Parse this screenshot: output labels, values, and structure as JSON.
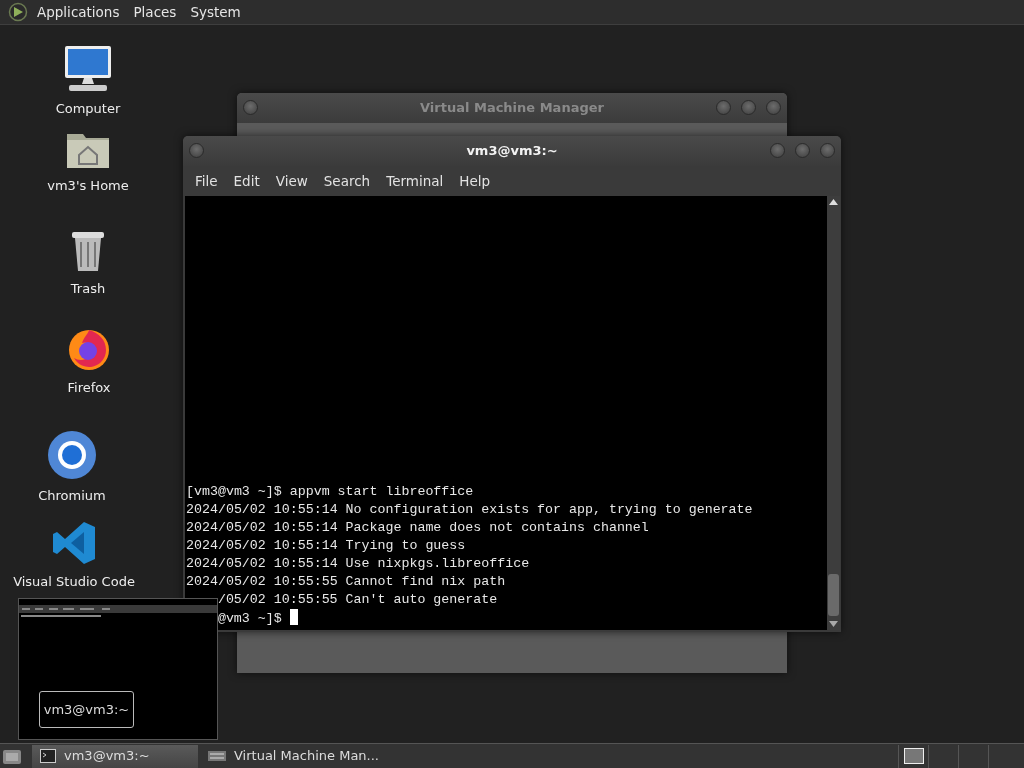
{
  "top_panel": {
    "menus": [
      "Applications",
      "Places",
      "System"
    ]
  },
  "desktop_icons": [
    {
      "label": "Computer",
      "kind": "computer"
    },
    {
      "label": "vm3's Home",
      "kind": "home"
    },
    {
      "label": "Trash",
      "kind": "trash"
    },
    {
      "label": "Firefox",
      "kind": "firefox"
    },
    {
      "label": "Chromium",
      "kind": "chromium"
    },
    {
      "label": "Visual Studio Code",
      "kind": "vscode"
    }
  ],
  "background_window": {
    "title": "Virtual Machine Manager",
    "active": false
  },
  "terminal_window": {
    "title": "vm3@vm3:~",
    "active": true,
    "menus": [
      "File",
      "Edit",
      "View",
      "Search",
      "Terminal",
      "Help"
    ],
    "lines": [
      {
        "text": "[vm3@vm3 ~]$ appvm start libreoffice",
        "kind": "full"
      },
      {
        "text": "2024/05/02 10:55:14 No configuration exists for app, trying to generate",
        "kind": "full"
      },
      {
        "text": "2024/05/02 10:55:14 Package name does not contains channel",
        "kind": "full"
      },
      {
        "text": "2024/05/02 10:55:14 Trying to guess",
        "kind": "full"
      },
      {
        "text": "2024/05/02 10:55:14 Use nixpkgs.libreoffice",
        "kind": "full"
      },
      {
        "text": "2024/05/02 10:55:55 Cannot find nix path",
        "kind": "full"
      },
      {
        "text": "/05/02 10:55:55 Can't auto generate",
        "kind": "cut"
      },
      {
        "text": "@vm3 ~]$",
        "kind": "cut",
        "cursor": true
      }
    ]
  },
  "window_preview": {
    "label": "vm3@vm3:~"
  },
  "taskbar": {
    "tasks": [
      {
        "label": "vm3@vm3:~",
        "kind": "terminal",
        "selected": true
      },
      {
        "label": "Virtual Machine Man...",
        "kind": "manager",
        "selected": false
      }
    ],
    "workspaces": [
      {
        "selected": true
      },
      {
        "selected": false
      },
      {
        "selected": false
      },
      {
        "selected": false
      }
    ]
  }
}
